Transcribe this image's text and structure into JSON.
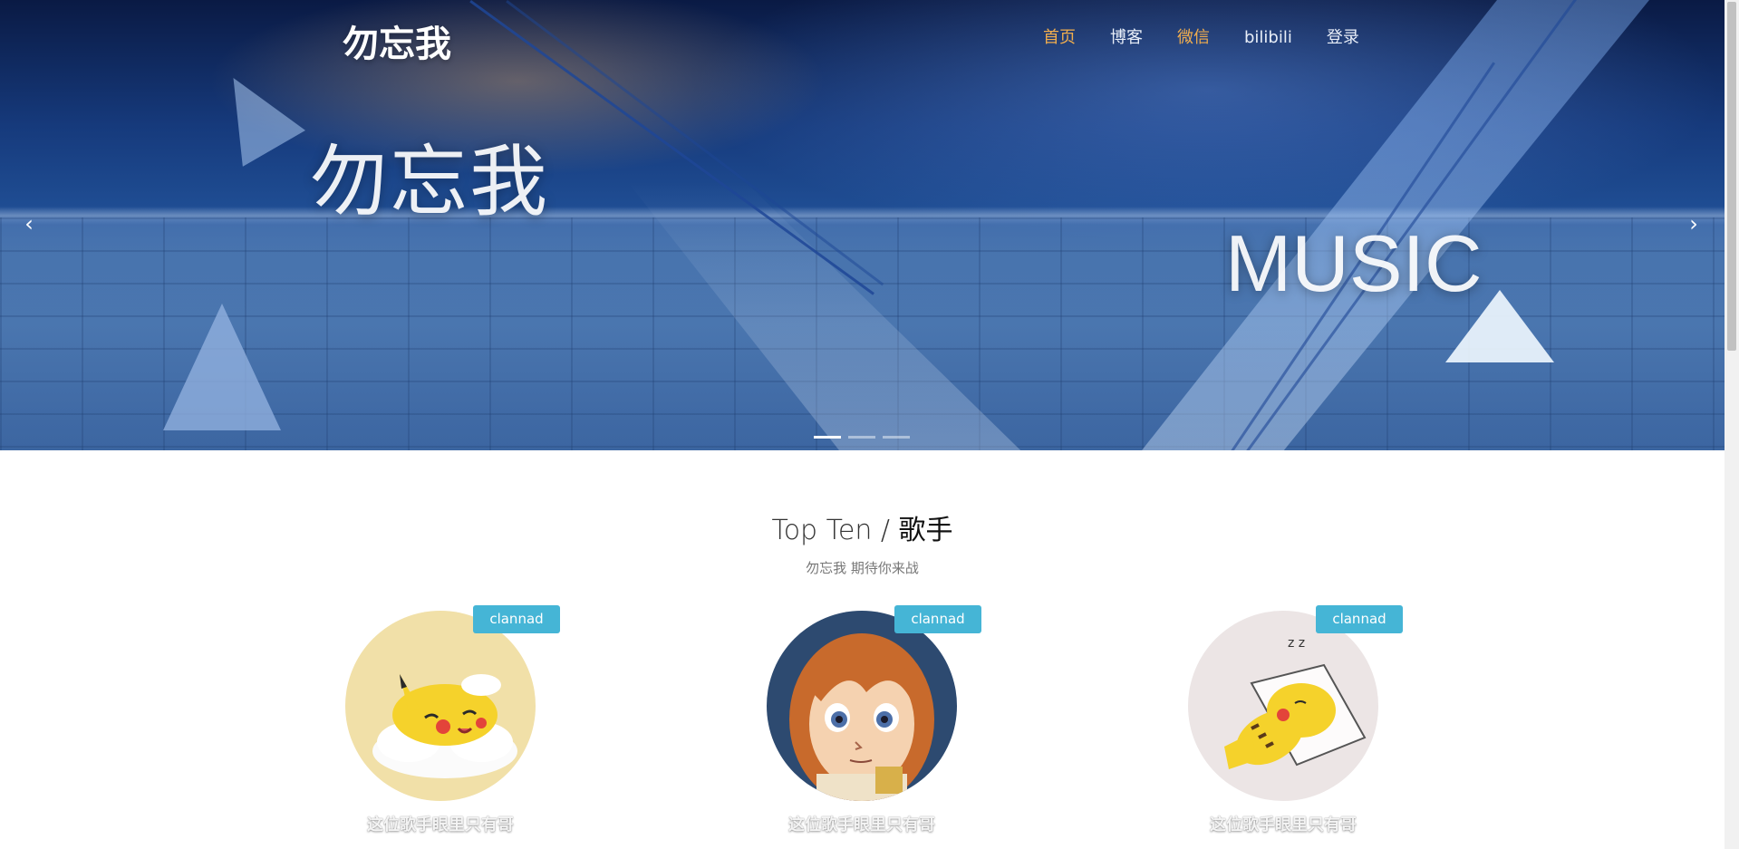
{
  "navbar": {
    "brand": "勿忘我",
    "links": [
      {
        "label": "首页",
        "highlight": true
      },
      {
        "label": "博客",
        "highlight": false
      },
      {
        "label": "微信",
        "highlight": true
      },
      {
        "label": "bilibili",
        "highlight": false
      },
      {
        "label": "登录",
        "highlight": false
      }
    ]
  },
  "hero": {
    "title_cn": "勿忘我",
    "title_en": "MUSIC",
    "prev_icon": "‹",
    "next_icon": "›",
    "slide_count": 3,
    "active_slide": 1
  },
  "section": {
    "title_en": "Top Ten / ",
    "title_cn": "歌手",
    "subtitle": "勿忘我 期待你来战"
  },
  "cards": [
    {
      "badge": "clannad",
      "caption": "这位歌手眼里只有哥",
      "image": "sleeping-pikachu-on-cloud"
    },
    {
      "badge": "clannad",
      "caption": "这位歌手眼里只有哥",
      "image": "anime-girl-portrait"
    },
    {
      "badge": "clannad",
      "caption": "这位歌手眼里只有哥",
      "image": "sleeping-pikachu-on-pillow"
    }
  ],
  "colors": {
    "accent": "#f0ad4e",
    "badge": "#45b5d6",
    "hero_blue": "#1f4d93"
  }
}
